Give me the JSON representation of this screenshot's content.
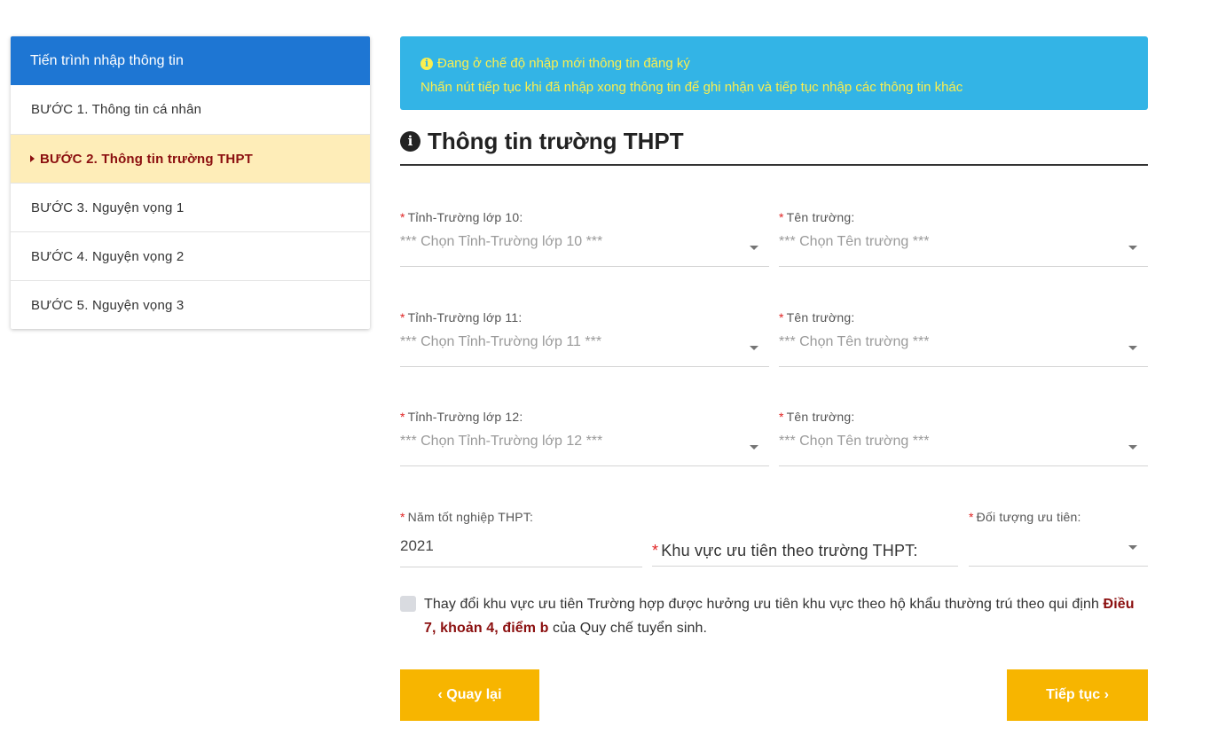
{
  "sidebar": {
    "title": "Tiến trình nhập thông tin",
    "steps": [
      {
        "label": "BƯỚC 1. Thông tin cá nhân"
      },
      {
        "label": "BƯỚC 2. Thông tin trường THPT"
      },
      {
        "label": "BƯỚC 3. Nguyện vọng 1"
      },
      {
        "label": "BƯỚC 4. Nguyện vọng 2"
      },
      {
        "label": "BƯỚC 5. Nguyện vọng 3"
      }
    ]
  },
  "notice": {
    "line1": "Đang ở chế độ nhập mới thông tin đăng ký",
    "line2": "Nhấn nút tiếp tục khi đã nhập xong thông tin để ghi nhận và tiếp tục nhập các thông tin khác"
  },
  "section": {
    "title": "Thông tin trường THPT"
  },
  "required_mark": "*",
  "rows": [
    {
      "province_label": "Tỉnh-Trường lớp 10:",
      "province_placeholder": "*** Chọn Tỉnh-Trường lớp 10 ***",
      "school_label": "Tên trường:",
      "school_placeholder": "*** Chọn Tên trường ***"
    },
    {
      "province_label": "Tỉnh-Trường lớp 11:",
      "province_placeholder": "*** Chọn Tỉnh-Trường lớp 11 ***",
      "school_label": "Tên trường:",
      "school_placeholder": "*** Chọn Tên trường ***"
    },
    {
      "province_label": "Tỉnh-Trường lớp 12:",
      "province_placeholder": "*** Chọn Tỉnh-Trường lớp 12 ***",
      "school_label": "Tên trường:",
      "school_placeholder": "*** Chọn Tên trường ***"
    }
  ],
  "graduation": {
    "label": "Năm tốt nghiệp THPT:",
    "value": "2021"
  },
  "area": {
    "label": "Khu vực ưu tiên theo trường THPT:"
  },
  "priority": {
    "label": "Đối tượng ưu tiên:",
    "value": ""
  },
  "checkbox": {
    "text": "Thay đổi khu vực ưu tiên Trường hợp được hưởng ưu tiên khu vực theo hộ khẩu thường trú theo qui định ",
    "law_ref": "Điều 7, khoản 4, điểm b",
    "suffix": " của Quy chế tuyển sinh."
  },
  "buttons": {
    "back": "‹ Quay lại",
    "next": "Tiếp tục ›"
  }
}
